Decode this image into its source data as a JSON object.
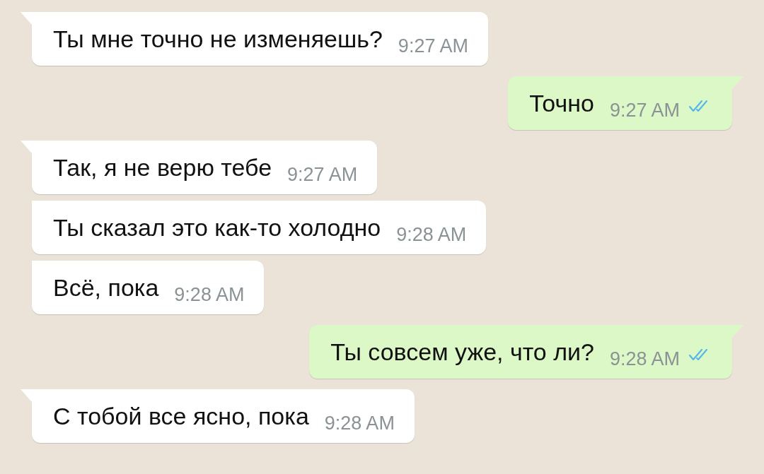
{
  "messages": [
    {
      "kind": "incoming",
      "text": "Ты мне точно не изменяешь?",
      "time": "9:27 AM",
      "tail": true
    },
    {
      "kind": "outgoing",
      "text": "Точно",
      "time": "9:27 AM",
      "tail": true,
      "read": true
    },
    {
      "kind": "incoming",
      "text": "Так, я не верю тебе",
      "time": "9:27 AM",
      "tail": true
    },
    {
      "kind": "incoming",
      "text": "Ты сказал это как-то холодно",
      "time": "9:28 AM",
      "tail": false
    },
    {
      "kind": "incoming",
      "text": "Всё, пока",
      "time": "9:28 AM",
      "tail": false
    },
    {
      "kind": "outgoing",
      "text": "Ты совсем уже, что ли?",
      "time": "9:28 AM",
      "tail": true,
      "read": true
    },
    {
      "kind": "incoming",
      "text": "С тобой все ясно, пока",
      "time": "9:28 AM",
      "tail": true
    }
  ]
}
